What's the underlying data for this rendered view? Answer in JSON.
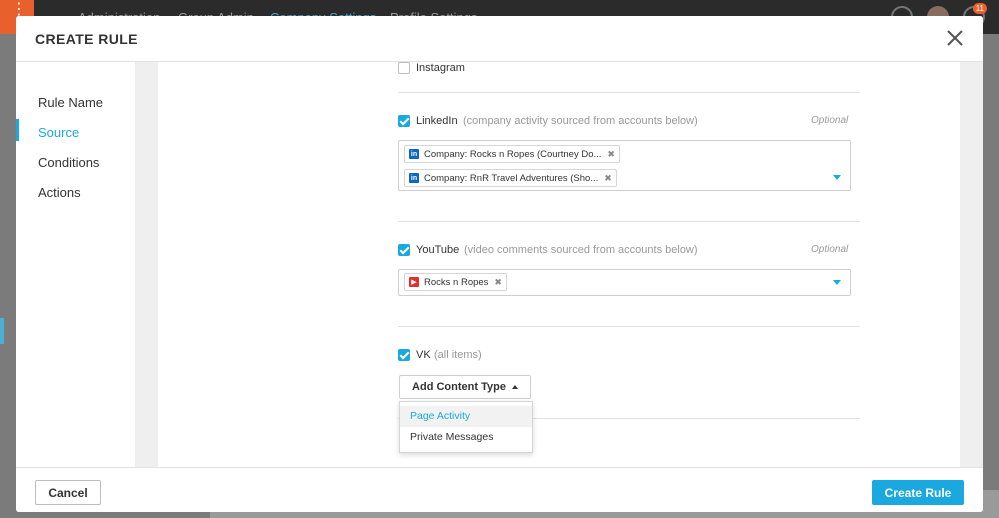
{
  "background": {
    "nav_items": [
      "Administration",
      "Group Admin",
      "Company Settings",
      "Profile Settings"
    ],
    "notification_count": "11"
  },
  "modal": {
    "title": "CREATE RULE",
    "sidebar": {
      "items": [
        {
          "label": "Rule Name"
        },
        {
          "label": "Source",
          "active": true
        },
        {
          "label": "Conditions"
        },
        {
          "label": "Actions"
        }
      ]
    },
    "sources": {
      "instagram": {
        "label": "Instagram",
        "checked": false
      },
      "linkedin": {
        "label": "LinkedIn",
        "description": "(company activity sourced from accounts below)",
        "optional": "Optional",
        "checked": true,
        "tags": [
          "Company: Rocks n Ropes (Courtney Do...",
          "Company: RnR Travel Adventures (Sho..."
        ]
      },
      "youtube": {
        "label": "YouTube",
        "description": "(video comments sourced from accounts below)",
        "optional": "Optional",
        "checked": true,
        "tags": [
          "Rocks n Ropes"
        ]
      },
      "vk": {
        "label": "VK",
        "description": "(all items)",
        "checked": true,
        "add_content_type": "Add Content Type",
        "dropdown": [
          "Page Activity",
          "Private Messages"
        ],
        "dropdown_highlighted": "Page Activity"
      }
    },
    "footer": {
      "cancel_label": "Cancel",
      "create_label": "Create Rule"
    }
  },
  "colors": {
    "accent": "#19a9e0",
    "linkedin": "#0a66c2",
    "youtube": "#e0312f",
    "brand_orange": "#e8612c"
  }
}
